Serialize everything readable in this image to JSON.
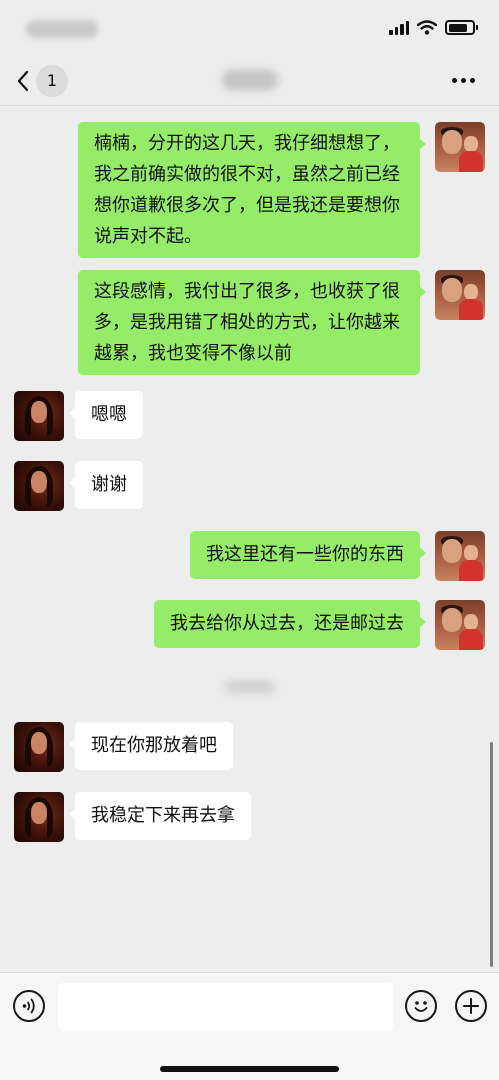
{
  "nav": {
    "unread_count": "1"
  },
  "messages": [
    {
      "side": "out",
      "text": "楠楠，分开的这几天，我仔细想想了，我之前确实做的很不对，虽然之前已经想你道歉很多次了，但是我还是要想你说声对不起。"
    },
    {
      "side": "out",
      "text": "这段感情，我付出了很多，也收获了很多，是我用错了相处的方式，让你越来越累，我也变得不像以前"
    },
    {
      "side": "in",
      "text": "嗯嗯"
    },
    {
      "side": "in",
      "text": "谢谢"
    },
    {
      "side": "out",
      "text": "我这里还有一些你的东西"
    },
    {
      "side": "out",
      "text": "我去给你从过去，还是邮过去"
    },
    {
      "side": "in",
      "text": "现在你那放着吧"
    },
    {
      "side": "in",
      "text": "我稳定下来再去拿"
    }
  ],
  "input": {
    "value": ""
  },
  "icons": {
    "back": "chevron-left-icon",
    "more": "more-dots-icon",
    "voice": "voice-icon",
    "emoji": "emoji-icon",
    "plus": "plus-icon"
  },
  "colors": {
    "bubble_out": "#95ec69",
    "bubble_in": "#ffffff",
    "background": "#ededed"
  }
}
